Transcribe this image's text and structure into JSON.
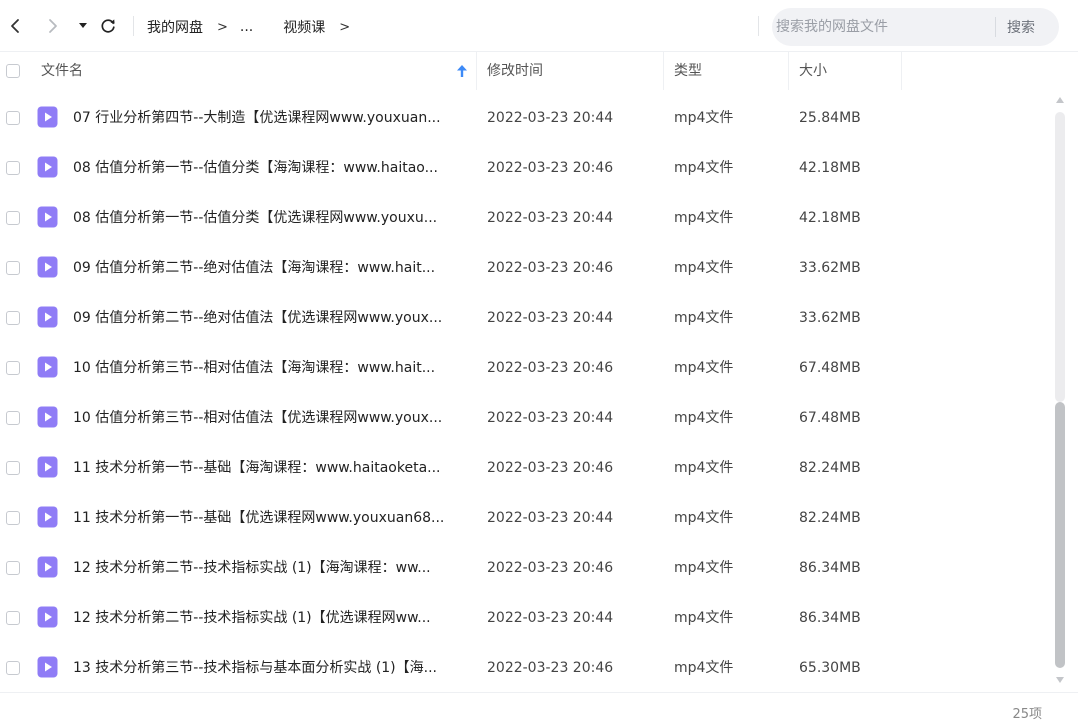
{
  "nav": {
    "breadcrumb": [
      "我的网盘",
      "...",
      "视频课"
    ],
    "separator": ">"
  },
  "search": {
    "placeholder": "搜索我的网盘文件",
    "button_label": "搜索"
  },
  "columns": {
    "name": "文件名",
    "modified": "修改时间",
    "type": "类型",
    "size": "大小"
  },
  "files": [
    {
      "name": "07 行业分析第四节--大制造【优选课程网www.youxuan...",
      "modified": "2022-03-23 20:44",
      "type": "mp4文件",
      "size": "25.84MB"
    },
    {
      "name": "08 估值分析第一节--估值分类【海淘课程：www.haitao...",
      "modified": "2022-03-23 20:46",
      "type": "mp4文件",
      "size": "42.18MB"
    },
    {
      "name": "08 估值分析第一节--估值分类【优选课程网www.youxu...",
      "modified": "2022-03-23 20:44",
      "type": "mp4文件",
      "size": "42.18MB"
    },
    {
      "name": "09 估值分析第二节--绝对估值法【海淘课程：www.hait...",
      "modified": "2022-03-23 20:46",
      "type": "mp4文件",
      "size": "33.62MB"
    },
    {
      "name": "09 估值分析第二节--绝对估值法【优选课程网www.youx...",
      "modified": "2022-03-23 20:44",
      "type": "mp4文件",
      "size": "33.62MB"
    },
    {
      "name": "10 估值分析第三节--相对估值法【海淘课程：www.hait...",
      "modified": "2022-03-23 20:46",
      "type": "mp4文件",
      "size": "67.48MB"
    },
    {
      "name": "10 估值分析第三节--相对估值法【优选课程网www.youx...",
      "modified": "2022-03-23 20:44",
      "type": "mp4文件",
      "size": "67.48MB"
    },
    {
      "name": "11 技术分析第一节--基础【海淘课程：www.haitaoketa...",
      "modified": "2022-03-23 20:46",
      "type": "mp4文件",
      "size": "82.24MB"
    },
    {
      "name": "11 技术分析第一节--基础【优选课程网www.youxuan68...",
      "modified": "2022-03-23 20:44",
      "type": "mp4文件",
      "size": "82.24MB"
    },
    {
      "name": "12 技术分析第二节--技术指标实战 (1)【海淘课程：ww...",
      "modified": "2022-03-23 20:46",
      "type": "mp4文件",
      "size": "86.34MB"
    },
    {
      "name": "12 技术分析第二节--技术指标实战 (1)【优选课程网ww...",
      "modified": "2022-03-23 20:44",
      "type": "mp4文件",
      "size": "86.34MB"
    },
    {
      "name": "13 技术分析第三节--技术指标与基本面分析实战 (1)【海...",
      "modified": "2022-03-23 20:46",
      "type": "mp4文件",
      "size": "65.30MB"
    }
  ],
  "footer": {
    "count": "25项"
  },
  "colors": {
    "accent": "#3d8af7",
    "file_icon": "#8f7cf6",
    "scroll_thumb": "#c1c3c6"
  },
  "icons": {
    "back": "chevron-left-icon",
    "forward": "chevron-right-icon",
    "dropdown": "caret-down-icon",
    "refresh": "refresh-icon",
    "sort": "arrow-up-icon",
    "file": "video-file-icon"
  }
}
